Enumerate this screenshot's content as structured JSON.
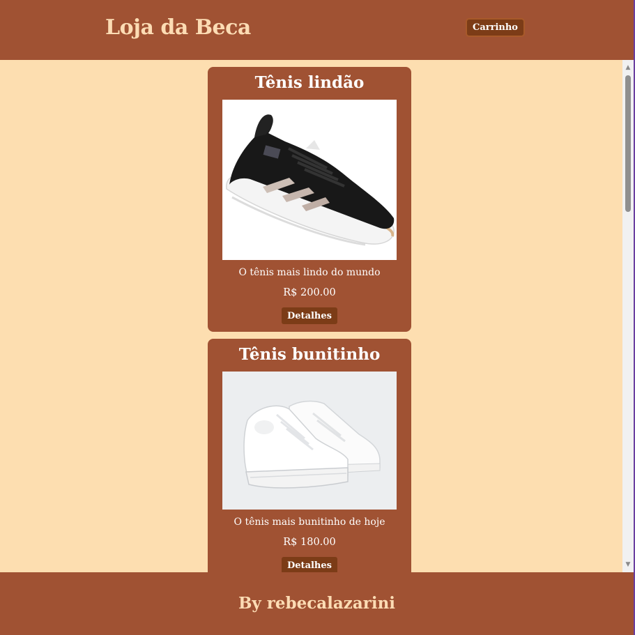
{
  "header": {
    "logo": "Loja da Beca",
    "cart_label": "Carrinho"
  },
  "products": [
    {
      "title": "Tênis lindão",
      "description": "O tênis mais lindo do mundo",
      "price": "R$ 200.00",
      "details_label": "Detalhes",
      "image_icon": "black-sneaker-image"
    },
    {
      "title": "Tênis bunitinho",
      "description": "O tênis mais bunitinho de hoje",
      "price": "R$ 180.00",
      "details_label": "Detalhes",
      "image_icon": "white-sneakers-image"
    }
  ],
  "footer": {
    "text": "By rebecalazarini"
  },
  "colors": {
    "background": "#fddeb0",
    "brand": "#a05233",
    "button": "#7c3c17",
    "logo_text": "#fcdcb4"
  }
}
